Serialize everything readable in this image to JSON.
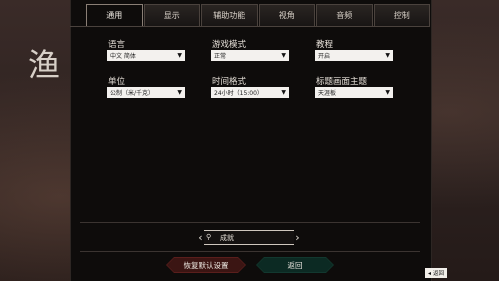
{
  "background": {
    "title_char": "渔"
  },
  "tabs": [
    {
      "label": "通用",
      "active": true
    },
    {
      "label": "显示",
      "active": false
    },
    {
      "label": "辅助功能",
      "active": false
    },
    {
      "label": "视角",
      "active": false
    },
    {
      "label": "音频",
      "active": false
    },
    {
      "label": "控制",
      "active": false
    }
  ],
  "settings": {
    "language": {
      "label": "语言",
      "value": "中文 简体"
    },
    "game_mode": {
      "label": "游戏模式",
      "value": "正常"
    },
    "tutorial": {
      "label": "教程",
      "value": "开启"
    },
    "units": {
      "label": "单位",
      "value": "公制（米/千克）"
    },
    "time_format": {
      "label": "时间格式",
      "value": "24小时（15:00）"
    },
    "title_theme": {
      "label": "标题画面主题",
      "value": "天涯板"
    }
  },
  "preset": {
    "label": "成就",
    "icon": "medal-icon"
  },
  "buttons": {
    "reset_label": "恢复默认设置",
    "back_label": "返回"
  },
  "hint": {
    "label": "返回",
    "icon": "esc-key-icon"
  },
  "colors": {
    "panel": "#0e0c0b",
    "reset_button": "#5a1e1c",
    "back_button": "#12382f",
    "select_bg": "#f3f1ee"
  }
}
